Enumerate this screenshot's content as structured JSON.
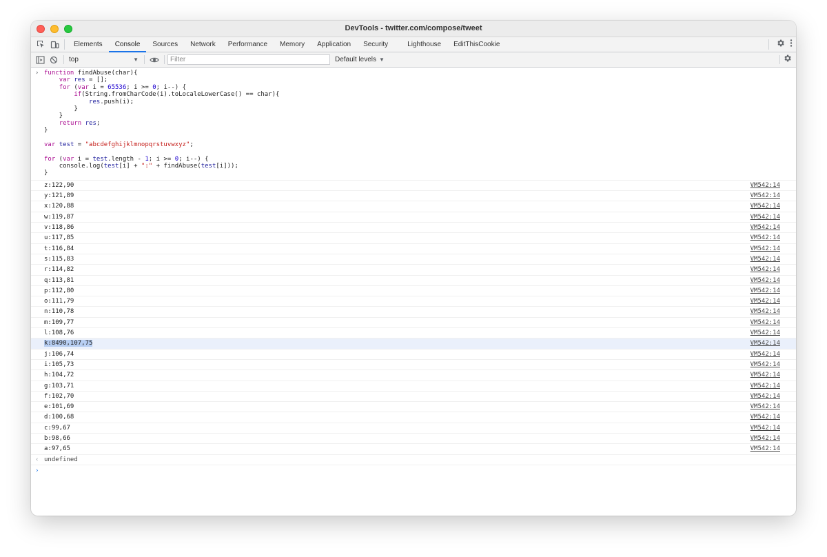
{
  "window": {
    "title": "DevTools - twitter.com/compose/tweet"
  },
  "tabs": [
    {
      "label": "Elements"
    },
    {
      "label": "Console"
    },
    {
      "label": "Sources"
    },
    {
      "label": "Network"
    },
    {
      "label": "Performance"
    },
    {
      "label": "Memory"
    },
    {
      "label": "Application"
    },
    {
      "label": "Security"
    },
    {
      "label": "Lighthouse"
    },
    {
      "label": "EditThisCookie"
    }
  ],
  "toolbar": {
    "context": "top",
    "filter_placeholder": "Filter",
    "levels": "Default levels"
  },
  "input_code": [
    "function findAbuse(char){",
    "    var res = [];",
    "    for (var i = 65536; i >= 0; i--) {",
    "        if(String.fromCharCode(i).toLocaleLowerCase() == char){",
    "            res.push(i);",
    "        }",
    "    }",
    "    return res;",
    "}",
    "",
    "var test = \"abcdefghijklmnopqrstuvwxyz\";",
    "",
    "for (var i = test.length - 1; i >= 0; i--) {",
    "    console.log(test[i] + \":\" + findAbuse(test[i]));",
    "}"
  ],
  "logs": [
    {
      "text": "z:122,90",
      "source": "VM542:14"
    },
    {
      "text": "y:121,89",
      "source": "VM542:14"
    },
    {
      "text": "x:120,88",
      "source": "VM542:14"
    },
    {
      "text": "w:119,87",
      "source": "VM542:14"
    },
    {
      "text": "v:118,86",
      "source": "VM542:14"
    },
    {
      "text": "u:117,85",
      "source": "VM542:14"
    },
    {
      "text": "t:116,84",
      "source": "VM542:14"
    },
    {
      "text": "s:115,83",
      "source": "VM542:14"
    },
    {
      "text": "r:114,82",
      "source": "VM542:14"
    },
    {
      "text": "q:113,81",
      "source": "VM542:14"
    },
    {
      "text": "p:112,80",
      "source": "VM542:14"
    },
    {
      "text": "o:111,79",
      "source": "VM542:14"
    },
    {
      "text": "n:110,78",
      "source": "VM542:14"
    },
    {
      "text": "m:109,77",
      "source": "VM542:14"
    },
    {
      "text": "l:108,76",
      "source": "VM542:14"
    },
    {
      "text": "k:8490,107,75",
      "source": "VM542:14",
      "highlighted": true
    },
    {
      "text": "j:106,74",
      "source": "VM542:14"
    },
    {
      "text": "i:105,73",
      "source": "VM542:14"
    },
    {
      "text": "h:104,72",
      "source": "VM542:14"
    },
    {
      "text": "g:103,71",
      "source": "VM542:14"
    },
    {
      "text": "f:102,70",
      "source": "VM542:14"
    },
    {
      "text": "e:101,69",
      "source": "VM542:14"
    },
    {
      "text": "d:100,68",
      "source": "VM542:14"
    },
    {
      "text": "c:99,67",
      "source": "VM542:14"
    },
    {
      "text": "b:98,66",
      "source": "VM542:14"
    },
    {
      "text": "a:97,65",
      "source": "VM542:14"
    }
  ],
  "result": "undefined",
  "colors": {
    "accent": "#1a73e8",
    "highlight_row": "#eaf0fb",
    "selection": "#b7cef2"
  },
  "icons": {
    "inspect": "inspect-element-icon",
    "device": "device-toolbar-icon",
    "settings": "gear-icon",
    "menu": "kebab-menu-icon",
    "sidebar": "sidebar-toggle-icon",
    "clear": "clear-console-icon",
    "eye": "eye-icon"
  }
}
